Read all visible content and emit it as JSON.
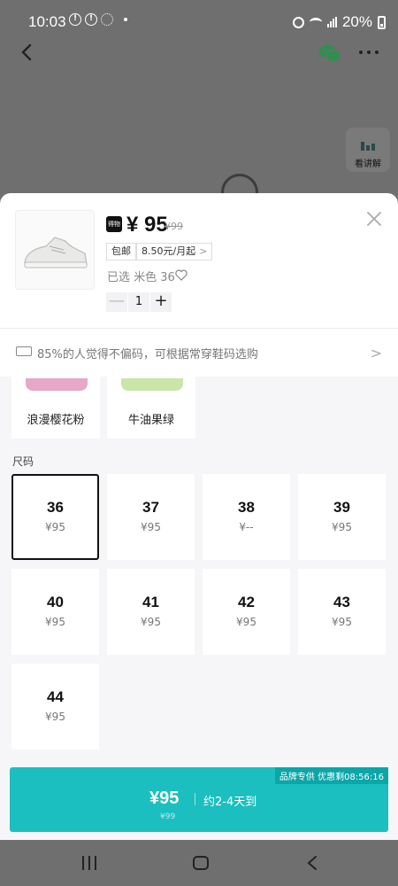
{
  "status_bar": {
    "time": "10:03",
    "battery": "20%"
  },
  "header": {
    "explain_label": "看讲解"
  },
  "product": {
    "brand_badge": "得物",
    "price": "¥ 95",
    "old_price": "¥99",
    "tags": [
      "包邮",
      "8.50元/月起"
    ],
    "selected": "已选 米色 36",
    "quantity": "1",
    "qty_minus": "—",
    "qty_plus": "+"
  },
  "fit_tip": "85%的人觉得不偏码，可根据常穿鞋码选购",
  "colors": [
    {
      "name": "浪漫樱花粉",
      "swatch": "#e6a7c8"
    },
    {
      "name": "牛油果绿",
      "swatch": "#c8e6a8"
    }
  ],
  "size_heading": "尺码",
  "sizes": [
    {
      "size": "36",
      "price": "¥95"
    },
    {
      "size": "37",
      "price": "¥95"
    },
    {
      "size": "38",
      "price": "¥--"
    },
    {
      "size": "39",
      "price": "¥95"
    },
    {
      "size": "40",
      "price": "¥95"
    },
    {
      "size": "41",
      "price": "¥95"
    },
    {
      "size": "42",
      "price": "¥95"
    },
    {
      "size": "43",
      "price": "¥95"
    },
    {
      "size": "44",
      "price": "¥95"
    }
  ],
  "buy": {
    "promo": "品牌专供 优惠剩08:56:16",
    "price": "¥95",
    "eta": "约2-4天到",
    "old_price": "¥99"
  },
  "colors_theme": {
    "accent": "#1bbfbf",
    "promo": "#0aa6a8",
    "overlay": "#6f6f6f"
  }
}
